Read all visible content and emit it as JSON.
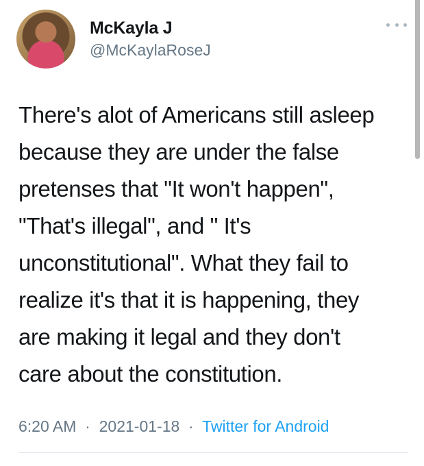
{
  "author": {
    "display_name": "McKayla J",
    "handle": "@McKaylaRoseJ"
  },
  "tweet": {
    "lines": [
      "There's alot of Americans still asleep",
      "because they are under the false",
      "pretenses that \"It won't happen\",",
      "\"That's illegal\", and \" It's",
      "unconstitutional\". What they fail to",
      "realize it's that it is happening, they",
      "are making it legal and they don't",
      "care about the constitution."
    ],
    "time": "6:20 AM",
    "separator": "·",
    "date": "2021-01-18",
    "source": "Twitter for Android"
  },
  "icons": {
    "more": "more-options-icon",
    "avatar": "profile-photo"
  },
  "colors": {
    "text": "#14171a",
    "secondary": "#657786",
    "link": "#1da1f2"
  }
}
